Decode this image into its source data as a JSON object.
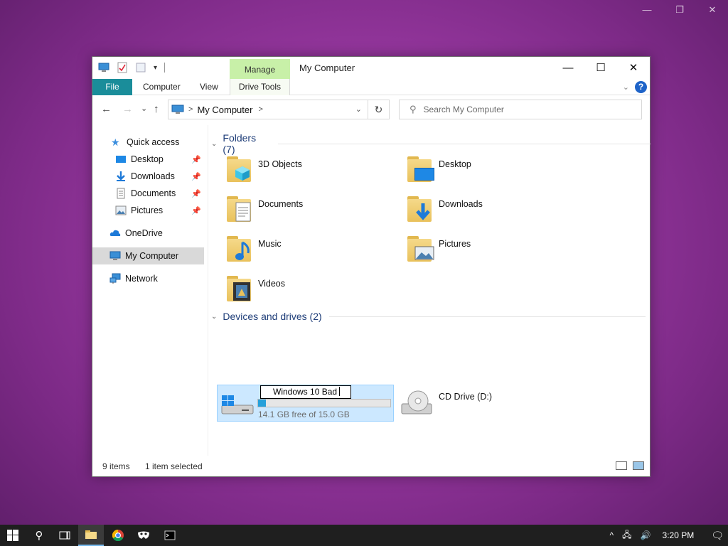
{
  "desktop": {
    "vm_controls": [
      "—",
      "❐",
      "✕"
    ]
  },
  "window": {
    "title": "My Computer",
    "manage_tab": "Manage",
    "buttons": {
      "minimize": "—",
      "maximize": "☐",
      "close": "✕"
    },
    "ribbon_tabs": {
      "file": "File",
      "computer": "Computer",
      "view": "View",
      "drive_tools": "Drive Tools"
    },
    "help": "?"
  },
  "navigation": {
    "back": "←",
    "forward": "→",
    "recent": "⌄",
    "up": "↑",
    "address": {
      "crumb": "My Computer",
      "separator": ">",
      "dropdown": "⌄"
    },
    "refresh": "↻",
    "search_placeholder": "Search My Computer"
  },
  "sidebar": {
    "items": [
      {
        "label": "Quick access",
        "icon": "star-icon"
      },
      {
        "label": "Desktop",
        "icon": "desktop-icon",
        "pinned": true
      },
      {
        "label": "Downloads",
        "icon": "download-icon",
        "pinned": true
      },
      {
        "label": "Documents",
        "icon": "document-icon",
        "pinned": true
      },
      {
        "label": "Pictures",
        "icon": "pictures-icon",
        "pinned": true
      },
      {
        "label": "OneDrive",
        "icon": "cloud-icon"
      },
      {
        "label": "My Computer",
        "icon": "computer-icon",
        "selected": true
      },
      {
        "label": "Network",
        "icon": "network-icon"
      }
    ]
  },
  "content": {
    "folders_header": "Folders (7)",
    "folders": [
      {
        "name": "3D Objects",
        "icon": "3d-objects-icon"
      },
      {
        "name": "Desktop",
        "icon": "desktop-folder-icon"
      },
      {
        "name": "Documents",
        "icon": "documents-folder-icon"
      },
      {
        "name": "Downloads",
        "icon": "downloads-folder-icon"
      },
      {
        "name": "Music",
        "icon": "music-folder-icon"
      },
      {
        "name": "Pictures",
        "icon": "pictures-folder-icon"
      },
      {
        "name": "Videos",
        "icon": "videos-folder-icon"
      }
    ],
    "devices_header": "Devices and drives (2)",
    "drive": {
      "rename_value": "Windows 10 Bad",
      "free_text": "14.1 GB free of 15.0 GB",
      "used_fraction": 0.06
    },
    "cd_drive": {
      "name": "CD Drive (D:)"
    }
  },
  "status": {
    "items": "9 items",
    "selected": "1 item selected"
  },
  "taskbar": {
    "time": "3:20 PM",
    "tray_up": "^"
  },
  "colors": {
    "file_tab": "#1a8d9a",
    "manage_tab": "#c8f0a8",
    "selection": "#cce8ff",
    "usage_fill": "#26a0da",
    "group_header": "#1e3d78"
  }
}
